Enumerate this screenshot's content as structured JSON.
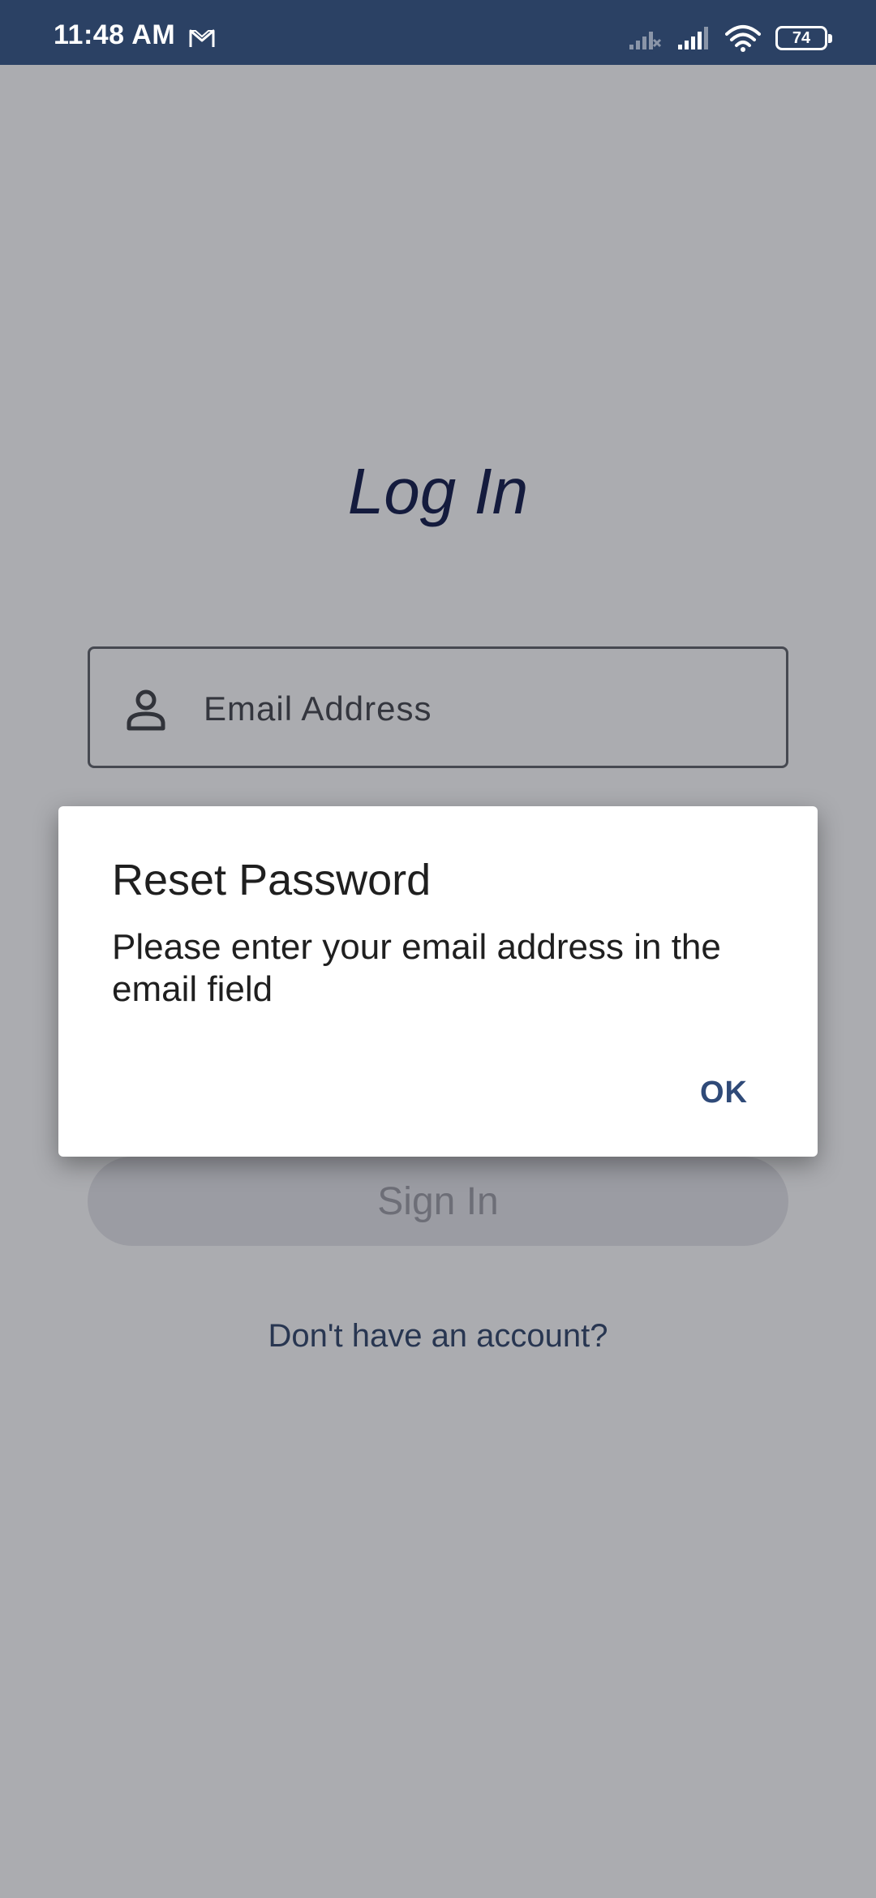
{
  "status_bar": {
    "time": "11:48 AM",
    "battery_level": "74",
    "icons": [
      "gmail-icon",
      "signal-no-service-icon",
      "signal-icon",
      "wifi-icon",
      "battery-icon"
    ]
  },
  "login": {
    "title": "Log In",
    "email_placeholder": "Email Address",
    "email_value": "",
    "sign_in_label": "Sign In",
    "signup_link": "Don't have an account?"
  },
  "dialog": {
    "title": "Reset Password",
    "message": "Please enter your email address in the email field",
    "ok_label": "OK"
  },
  "colors": {
    "status_bar": "#2b4164",
    "title": "#0c1646",
    "link": "#2c4166",
    "dialog_button": "#2f4a78"
  }
}
